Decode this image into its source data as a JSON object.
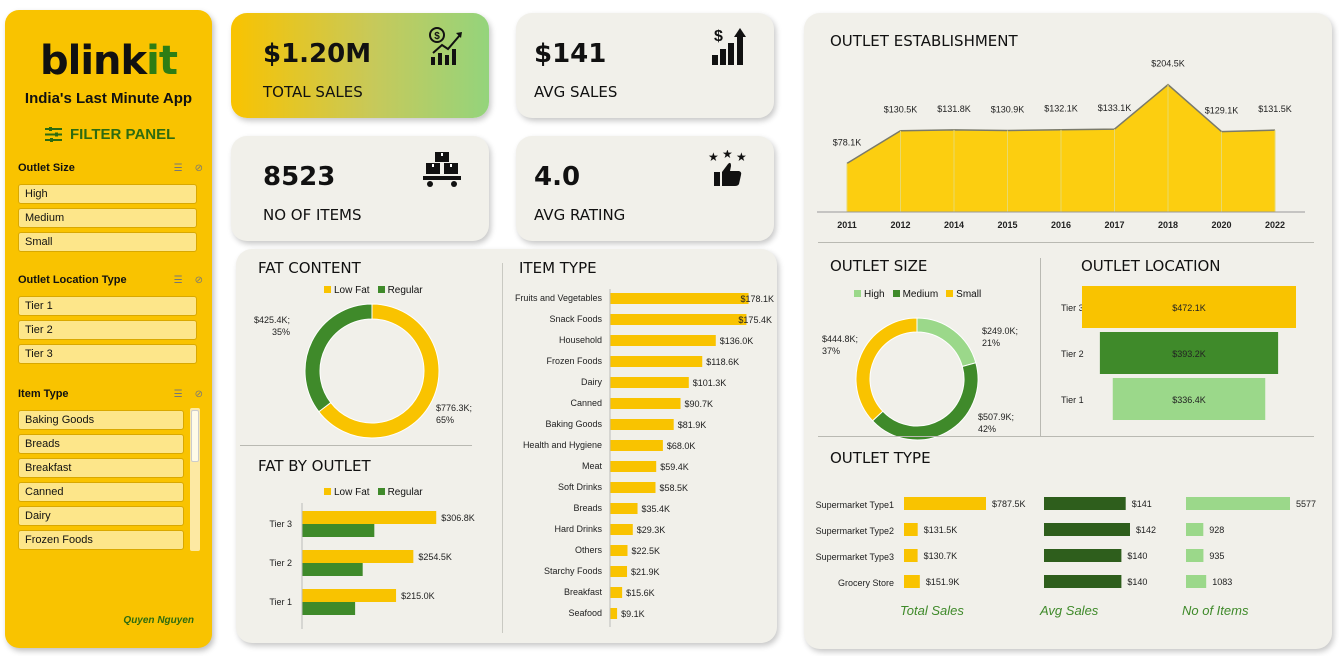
{
  "sidebar": {
    "logo_part1": "blink",
    "logo_part2": "it",
    "tagline": "India's Last Minute App",
    "filter_title": "FILTER PANEL",
    "sections": [
      {
        "title": "Outlet Size",
        "items": [
          "High",
          "Medium",
          "Small"
        ]
      },
      {
        "title": "Outlet Location Type",
        "items": [
          "Tier 1",
          "Tier 2",
          "Tier 3"
        ]
      },
      {
        "title": "Item Type",
        "items": [
          "Baking Goods",
          "Breads",
          "Breakfast",
          "Canned",
          "Dairy",
          "Frozen Foods"
        ]
      }
    ],
    "author": "Quyen Nguyen"
  },
  "kpis": {
    "total_sales": {
      "value": "$1.20M",
      "label": "TOTAL SALES"
    },
    "avg_sales": {
      "value": "$141",
      "label": "AVG SALES"
    },
    "items": {
      "value": "8523",
      "label": "NO OF ITEMS"
    },
    "rating": {
      "value": "4.0",
      "label": "AVG RATING"
    }
  },
  "titles": {
    "fat_content": "FAT CONTENT",
    "fat_by_outlet": "FAT BY OUTLET",
    "item_type": "ITEM TYPE",
    "outlet_establishment": "OUTLET ESTABLISHMENT",
    "outlet_size": "OUTLET SIZE",
    "outlet_location": "OUTLET LOCATION",
    "outlet_type": "OUTLET TYPE"
  },
  "colors": {
    "yellow": "#f9c300",
    "dark_green": "#2e5e1c",
    "green": "#3f8a2a",
    "light_green": "#9bd88a",
    "accent_text": "#3f8a2a"
  },
  "chart_data": [
    {
      "id": "fat_content",
      "type": "pie",
      "legend": [
        "Low Fat",
        "Regular"
      ],
      "values": [
        776.3,
        425.4
      ],
      "labels": [
        [
          "$776.3K;",
          "65%"
        ],
        [
          "$425.4K;",
          "35%"
        ]
      ]
    },
    {
      "id": "fat_by_outlet",
      "type": "bar",
      "legend": [
        "Low Fat",
        "Regular"
      ],
      "categories": [
        "Tier 3",
        "Tier 2",
        "Tier 1"
      ],
      "series": [
        {
          "name": "Low Fat",
          "values": [
            306.8,
            254.5,
            215.0
          ],
          "labels": [
            "$306.8K",
            "$254.5K",
            "$215.0K"
          ]
        },
        {
          "name": "Regular",
          "values": [
            165.3,
            138.7,
            121.4
          ]
        }
      ],
      "xlim": [
        0,
        320
      ]
    },
    {
      "id": "item_type",
      "type": "bar",
      "categories": [
        "Fruits and Vegetables",
        "Snack Foods",
        "Household",
        "Frozen Foods",
        "Dairy",
        "Canned",
        "Baking Goods",
        "Health and Hygiene",
        "Meat",
        "Soft Drinks",
        "Breads",
        "Hard Drinks",
        "Others",
        "Starchy Foods",
        "Breakfast",
        "Seafood"
      ],
      "values": [
        178.1,
        175.4,
        136.0,
        118.6,
        101.3,
        90.7,
        81.9,
        68.0,
        59.4,
        58.5,
        35.4,
        29.3,
        22.5,
        21.9,
        15.6,
        9.1
      ],
      "labels": [
        "$178.1K",
        "$175.4K",
        "$136.0K",
        "$118.6K",
        "$101.3K",
        "$90.7K",
        "$81.9K",
        "$68.0K",
        "$59.4K",
        "$58.5K",
        "$35.4K",
        "$29.3K",
        "$22.5K",
        "$21.9K",
        "$15.6K",
        "$9.1K"
      ],
      "xlim": [
        0,
        180
      ]
    },
    {
      "id": "outlet_establishment",
      "type": "area",
      "x": [
        "2011",
        "2012",
        "2014",
        "2015",
        "2016",
        "2017",
        "2018",
        "2020",
        "2022"
      ],
      "values": [
        78.1,
        130.5,
        131.8,
        130.9,
        132.1,
        133.1,
        204.5,
        129.1,
        131.5
      ],
      "labels": [
        "$78.1K",
        "$130.5K",
        "$131.8K",
        "$130.9K",
        "$132.1K",
        "$133.1K",
        "$204.5K",
        "$129.1K",
        "$131.5K"
      ],
      "ylim": [
        0,
        220
      ]
    },
    {
      "id": "outlet_size",
      "type": "pie",
      "legend": [
        "High",
        "Medium",
        "Small"
      ],
      "values": [
        249.0,
        507.9,
        444.8
      ],
      "labels": [
        [
          "$249.0K;",
          "21%"
        ],
        [
          "$507.9K;",
          "42%"
        ],
        [
          "$444.8K;",
          "37%"
        ]
      ]
    },
    {
      "id": "outlet_location",
      "type": "bar",
      "categories": [
        "Tier 3",
        "Tier 2",
        "Tier 1"
      ],
      "values": [
        472.1,
        393.2,
        336.4
      ],
      "labels": [
        "$472.1K",
        "$393.2K",
        "$336.4K"
      ]
    },
    {
      "id": "outlet_type",
      "type": "table",
      "rows": [
        "Supermarket Type1",
        "Supermarket Type2",
        "Supermarket Type3",
        "Grocery Store"
      ],
      "columns": [
        {
          "name": "Total Sales",
          "values": [
            787.5,
            131.5,
            130.7,
            151.9
          ],
          "labels": [
            "$787.5K",
            "$131.5K",
            "$130.7K",
            "$151.9K"
          ]
        },
        {
          "name": "Avg Sales",
          "values": [
            141,
            142,
            140,
            140
          ],
          "labels": [
            "$141",
            "$142",
            "$140",
            "$140"
          ]
        },
        {
          "name": "No of Items",
          "values": [
            5577,
            928,
            935,
            1083
          ],
          "labels": [
            "5577",
            "928",
            "935",
            "1083"
          ]
        }
      ]
    }
  ]
}
